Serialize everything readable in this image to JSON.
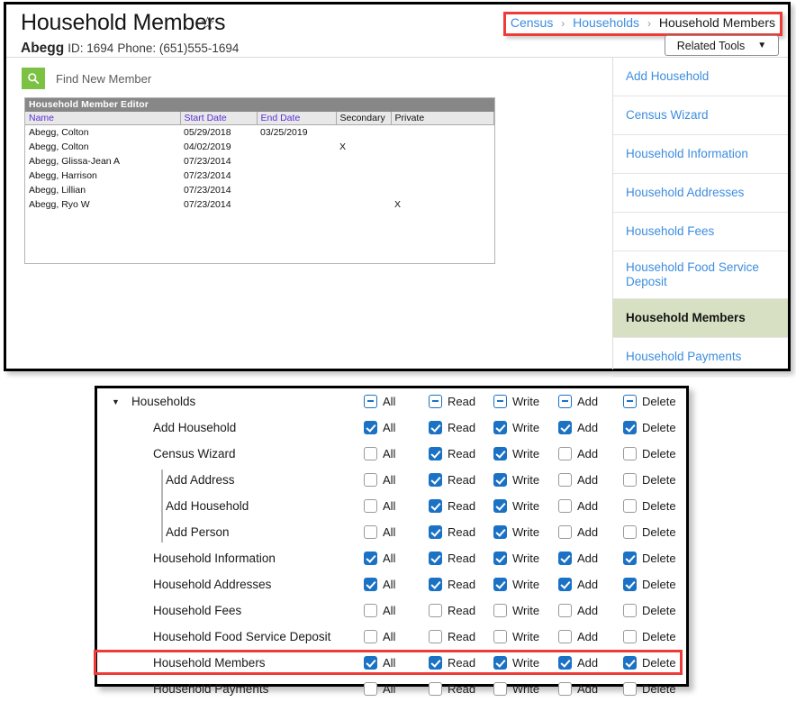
{
  "header": {
    "title": "Household Members",
    "star_icon": "star-outline-icon",
    "person_name": "Abegg",
    "person_id": "ID: 1694",
    "person_phone": "Phone: (651)555-1694",
    "related_tools_label": "Related Tools",
    "chevron": "∨"
  },
  "breadcrumb": {
    "items": [
      "Census",
      "Households",
      "Household Members"
    ],
    "separator": "›",
    "highlight_color": "#ef3b38",
    "link_color": "#3d8ddf"
  },
  "find": {
    "icon": "search-icon",
    "label": "Find New Member",
    "button_color": "#7bc143"
  },
  "editor": {
    "title": "Household Member Editor",
    "columns": [
      "Name",
      "Start Date",
      "End Date",
      "Secondary",
      "Private"
    ],
    "rows": [
      {
        "name": "Abegg, Colton",
        "start": "05/29/2018",
        "end": "03/25/2019",
        "secondary": "",
        "private": ""
      },
      {
        "name": "Abegg, Colton",
        "start": "04/02/2019",
        "end": "",
        "secondary": "X",
        "private": ""
      },
      {
        "name": "Abegg, Glissa-Jean A",
        "start": "07/23/2014",
        "end": "",
        "secondary": "",
        "private": ""
      },
      {
        "name": "Abegg, Harrison",
        "start": "07/23/2014",
        "end": "",
        "secondary": "",
        "private": ""
      },
      {
        "name": "Abegg, Lillian",
        "start": "07/23/2014",
        "end": "",
        "secondary": "",
        "private": ""
      },
      {
        "name": "Abegg, Ryo W",
        "start": "07/23/2014",
        "end": "",
        "secondary": "",
        "private": "X"
      }
    ]
  },
  "sidebar": {
    "items": [
      {
        "label": "Add Household",
        "active": false
      },
      {
        "label": "Census Wizard",
        "active": false
      },
      {
        "label": "Household Information",
        "active": false
      },
      {
        "label": "Household Addresses",
        "active": false
      },
      {
        "label": "Household Fees",
        "active": false
      },
      {
        "label": "Household Food Service Deposit",
        "active": false
      },
      {
        "label": "Household Members",
        "active": true
      },
      {
        "label": "Household Payments",
        "active": false
      }
    ],
    "active_bg": "#d7e0c2"
  },
  "permissions": {
    "columns": [
      "All",
      "Read",
      "Write",
      "Add",
      "Delete"
    ],
    "checked_color": "#1b72c4",
    "highlight_color": "#ef3b38",
    "rows": [
      {
        "label": "Households",
        "level": 0,
        "caret": "▼",
        "states": [
          "ind",
          "ind",
          "ind",
          "ind",
          "ind"
        ],
        "highlight": false
      },
      {
        "label": "Add Household",
        "level": 1,
        "states": [
          "on",
          "on",
          "on",
          "on",
          "on"
        ],
        "highlight": false
      },
      {
        "label": "Census Wizard",
        "level": 1,
        "states": [
          "off",
          "on",
          "on",
          "off",
          "off"
        ],
        "highlight": false
      },
      {
        "label": "Add Address",
        "level": 2,
        "states": [
          "off",
          "on",
          "on",
          "off",
          "off"
        ],
        "highlight": false
      },
      {
        "label": "Add Household",
        "level": 2,
        "states": [
          "off",
          "on",
          "on",
          "off",
          "off"
        ],
        "highlight": false
      },
      {
        "label": "Add Person",
        "level": 2,
        "states": [
          "off",
          "on",
          "on",
          "off",
          "off"
        ],
        "highlight": false
      },
      {
        "label": "Household Information",
        "level": 1,
        "states": [
          "on",
          "on",
          "on",
          "on",
          "on"
        ],
        "highlight": false
      },
      {
        "label": "Household Addresses",
        "level": 1,
        "states": [
          "on",
          "on",
          "on",
          "on",
          "on"
        ],
        "highlight": false
      },
      {
        "label": "Household Fees",
        "level": 1,
        "states": [
          "off",
          "off",
          "off",
          "off",
          "off"
        ],
        "highlight": false
      },
      {
        "label": "Household Food Service Deposit",
        "level": 1,
        "states": [
          "off",
          "off",
          "off",
          "off",
          "off"
        ],
        "highlight": false
      },
      {
        "label": "Household Members",
        "level": 1,
        "states": [
          "on",
          "on",
          "on",
          "on",
          "on"
        ],
        "highlight": true
      },
      {
        "label": "Household Payments",
        "level": 1,
        "states": [
          "off",
          "off",
          "off",
          "off",
          "off"
        ],
        "highlight": false
      }
    ]
  }
}
